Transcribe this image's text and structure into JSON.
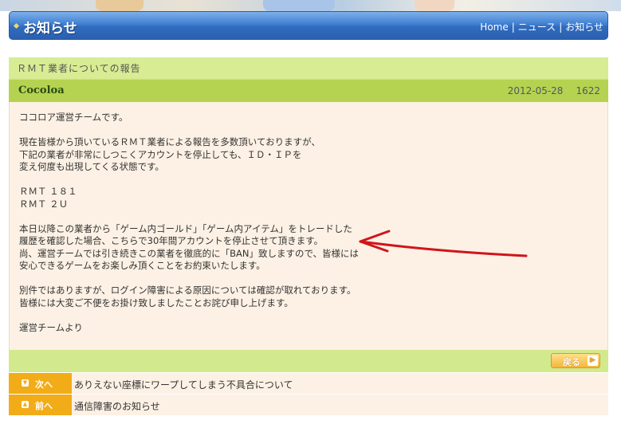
{
  "header": {
    "title": "お知らせ",
    "breadcrumb": [
      "Home",
      "ニュース",
      "お知らせ"
    ],
    "separator": "|"
  },
  "article": {
    "title": "ＲＭＴ業者についての報告",
    "author": "Cocoloa",
    "date": "2012-05-28",
    "views": "1622",
    "paragraphs": [
      "ココロア運営チームです。",
      "現在皆様から頂いているＲＭＴ業者による報告を多数頂いておりますが、\n下記の業者が非常にしつこくアカウントを停止しても、ＩＤ・ＩＰを\n変え何度も出現してくる状態です。",
      "ＲＭＴ １８１\nＲＭＴ ２Ｕ",
      "本日以降この業者から「ゲーム内ゴールド」「ゲーム内アイテム」をトレードした\n履歴を確認した場合、こちらで30年間アカウントを停止させて頂きます。\n尚、運営チームでは引き続きこの業者を徹底的に「BAN」致しますので、皆様には\n安心できるゲームをお楽しみ頂くことをお約束いたします。",
      "別件ではありますが、ログイン障害による原因については確認が取れております。\n皆様には大変ご不便をお掛け致しましたことお詫び申し上げます。",
      "運営チームより"
    ]
  },
  "footer": {
    "back_label": "戻る"
  },
  "nav": {
    "next": {
      "label": "次へ",
      "text": "ありえない座標にワープしてしまう不具合について"
    },
    "prev": {
      "label": "前へ",
      "text": "通信障害のお知らせ"
    }
  },
  "colors": {
    "header_blue": "#3f7fd2",
    "title_green": "#d8ec93",
    "meta_green": "#b5d350",
    "body_bg": "#fcf1e4",
    "nav_orange": "#f2ac17",
    "annotation_red": "#d0141c"
  },
  "icons": {
    "annotation": "red-arrow-annotation",
    "back": "chevron-right-icon",
    "next": "down-arrow-icon",
    "prev": "up-arrow-icon"
  }
}
